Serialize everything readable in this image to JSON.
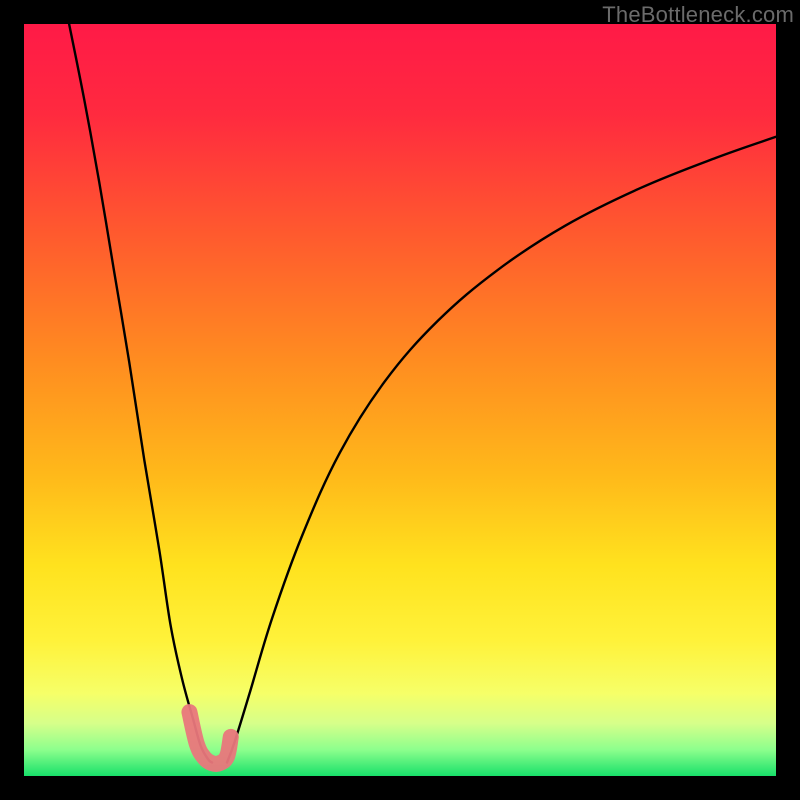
{
  "attribution": "TheBottleneck.com",
  "chart_data": {
    "type": "line",
    "title": "",
    "xlabel": "",
    "ylabel": "",
    "xlim": [
      0,
      100
    ],
    "ylim": [
      0,
      100
    ],
    "grid": false,
    "legend": false,
    "gradient_stops": [
      {
        "offset": 0.0,
        "color": "#ff1a47"
      },
      {
        "offset": 0.12,
        "color": "#ff2a3f"
      },
      {
        "offset": 0.28,
        "color": "#ff5a2e"
      },
      {
        "offset": 0.45,
        "color": "#ff8d20"
      },
      {
        "offset": 0.6,
        "color": "#ffb91a"
      },
      {
        "offset": 0.72,
        "color": "#ffe21e"
      },
      {
        "offset": 0.82,
        "color": "#fff23a"
      },
      {
        "offset": 0.89,
        "color": "#f6ff68"
      },
      {
        "offset": 0.93,
        "color": "#d6ff8a"
      },
      {
        "offset": 0.965,
        "color": "#8dff8d"
      },
      {
        "offset": 1.0,
        "color": "#18e06a"
      }
    ],
    "series": [
      {
        "name": "left-branch",
        "x": [
          6,
          8,
          10,
          12,
          14,
          16,
          18,
          19.5,
          21,
          22.5,
          23.5,
          24.5,
          25
        ],
        "y": [
          100,
          90,
          79,
          67,
          55,
          42,
          30,
          20,
          13,
          7.5,
          4,
          2.2,
          1.8
        ]
      },
      {
        "name": "right-branch",
        "x": [
          27,
          28,
          30,
          33,
          37,
          42,
          48,
          55,
          63,
          72,
          82,
          92,
          100
        ],
        "y": [
          1.8,
          4.5,
          11,
          21,
          32,
          43,
          52.5,
          60.5,
          67.3,
          73.2,
          78.2,
          82.2,
          85
        ]
      },
      {
        "name": "pink-marker-region",
        "x": [
          22,
          23,
          24,
          25,
          26,
          27,
          27.5
        ],
        "y": [
          8.5,
          4.2,
          2.4,
          1.7,
          1.7,
          2.6,
          5.2
        ]
      }
    ],
    "annotations": []
  }
}
